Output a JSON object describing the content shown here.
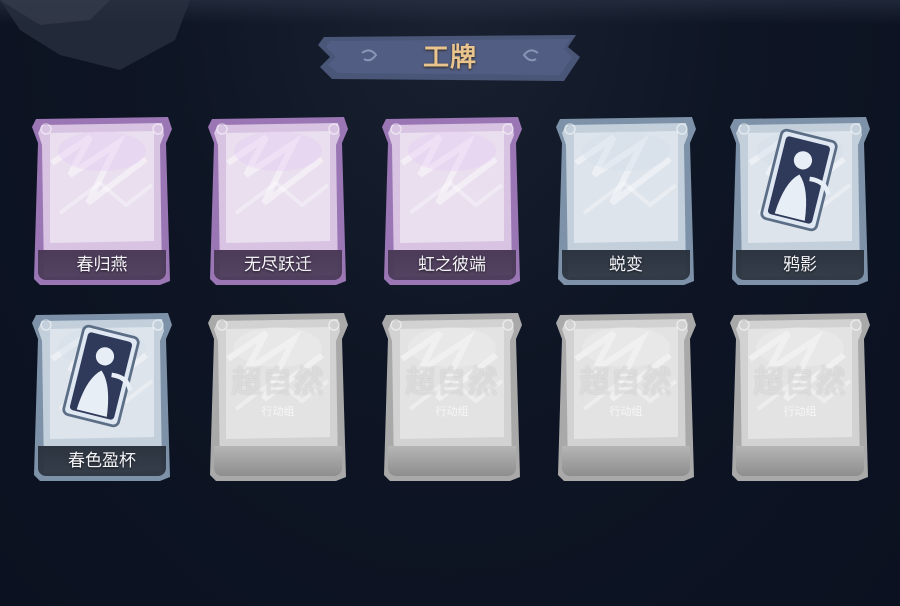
{
  "header": {
    "title": "工牌"
  },
  "badges": [
    {
      "label": "春归燕",
      "style": "purple",
      "icon": "blank-badge"
    },
    {
      "label": "无尽跃迁",
      "style": "purple",
      "icon": "blank-badge"
    },
    {
      "label": "虹之彼端",
      "style": "purple",
      "icon": "blank-badge"
    },
    {
      "label": "蜕变",
      "style": "blue",
      "icon": "blank-badge"
    },
    {
      "label": "鸦影",
      "style": "blue",
      "icon": "silhouette-card"
    },
    {
      "label": "春色盈杯",
      "style": "blue",
      "icon": "silhouette-card"
    },
    {
      "watermark": "超自然",
      "watermark_sub": "行动组",
      "style": "locked",
      "icon": "locked-badge"
    },
    {
      "watermark": "超自然",
      "watermark_sub": "行动组",
      "style": "locked",
      "icon": "locked-badge"
    },
    {
      "watermark": "超自然",
      "watermark_sub": "行动组",
      "style": "locked",
      "icon": "locked-badge"
    },
    {
      "watermark": "超自然",
      "watermark_sub": "行动组",
      "style": "locked",
      "icon": "locked-badge"
    }
  ],
  "colors": {
    "background": "#0c1220",
    "banner": "#4a5677",
    "title": "#e9c48e",
    "purple": "#b48cc8",
    "blue": "#8ea4b8",
    "locked": "#c9c9c9"
  }
}
